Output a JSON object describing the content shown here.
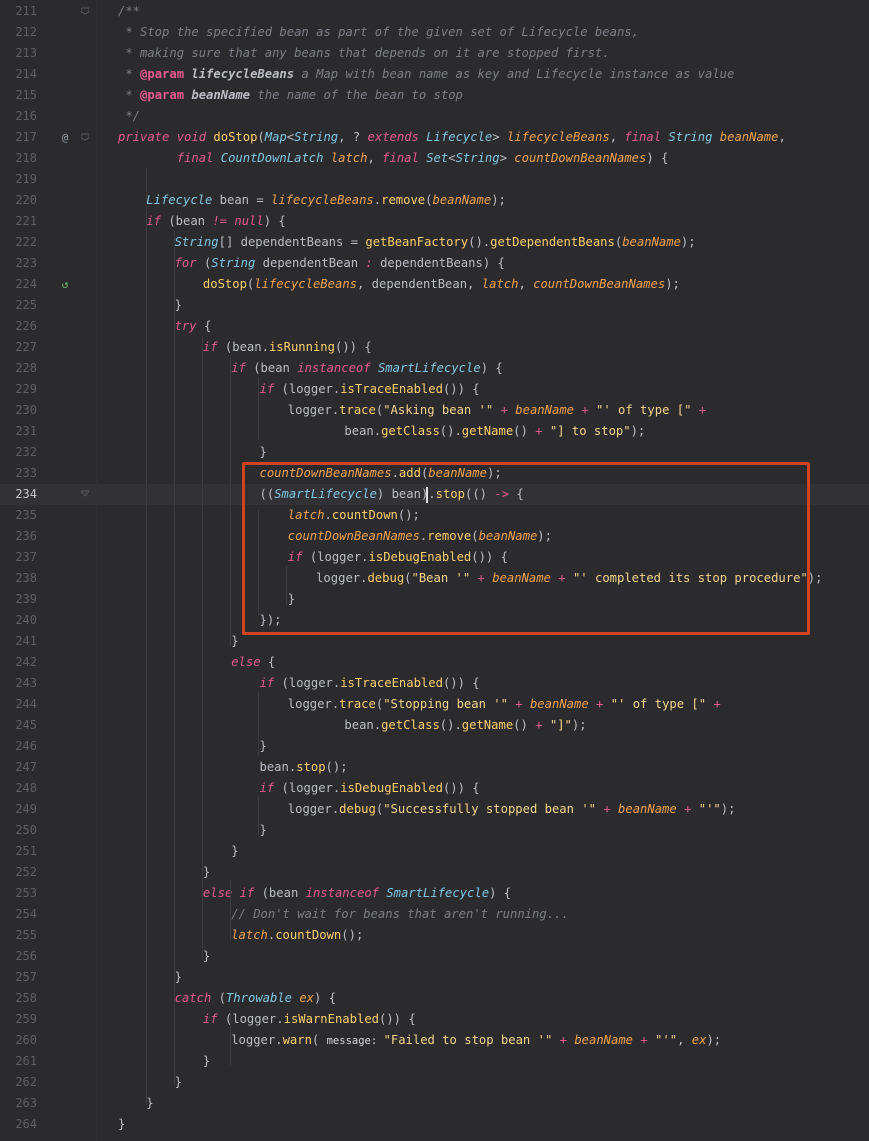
{
  "colors": {
    "background": "#2b2b2e",
    "keyword": "#ea5a8a",
    "type": "#7ec7e4",
    "method": "#ffcf6b",
    "field": "#f2a24d",
    "string": "#f5d68a",
    "comment": "#7d7f85",
    "plain": "#bcbec4",
    "highlight_box": "#d2431d"
  },
  "editor": {
    "first_line": 211,
    "current_line": 234,
    "lines": [
      {
        "n": 211,
        "indent": 0,
        "t": [
          [
            "/**",
            "c"
          ]
        ]
      },
      {
        "n": 212,
        "indent": 0,
        "t": [
          [
            " * Stop the specified bean as part of the given set of Lifecycle beans,",
            "c"
          ]
        ]
      },
      {
        "n": 213,
        "indent": 0,
        "t": [
          [
            " * making sure that any beans that depends on it are stopped first.",
            "c"
          ]
        ]
      },
      {
        "n": 214,
        "indent": 0,
        "t": [
          [
            " * ",
            "c"
          ],
          [
            "@param",
            "cb"
          ],
          [
            " lifecycleBeans",
            "cb2"
          ],
          [
            " a Map with bean name as key and Lifecycle instance as value",
            "c"
          ]
        ]
      },
      {
        "n": 215,
        "indent": 0,
        "t": [
          [
            " * ",
            "c"
          ],
          [
            "@param",
            "cb"
          ],
          [
            " beanName",
            "cb2"
          ],
          [
            " the name of the bean to stop",
            "c"
          ]
        ]
      },
      {
        "n": 216,
        "indent": 0,
        "t": [
          [
            " */",
            "c"
          ]
        ]
      },
      {
        "n": 217,
        "indent": 0,
        "t": [
          [
            "private void ",
            "k"
          ],
          [
            "doStop",
            "m"
          ],
          [
            "(",
            "p"
          ],
          [
            "Map",
            "t"
          ],
          [
            "<",
            "p"
          ],
          [
            "String",
            "t"
          ],
          [
            ", ? ",
            "p"
          ],
          [
            "extends ",
            "k"
          ],
          [
            "Lifecycle",
            "t"
          ],
          [
            "> ",
            "p"
          ],
          [
            "lifecycleBeans",
            "f"
          ],
          [
            ", ",
            "p"
          ],
          [
            "final ",
            "k"
          ],
          [
            "String ",
            "t"
          ],
          [
            "beanName",
            "f"
          ],
          [
            ",",
            "p"
          ]
        ]
      },
      {
        "n": 218,
        "indent": 0,
        "t": [
          [
            "        final ",
            "k"
          ],
          [
            "CountDownLatch ",
            "t"
          ],
          [
            "latch",
            "f"
          ],
          [
            ", ",
            "p"
          ],
          [
            "final ",
            "k"
          ],
          [
            "Set",
            "t"
          ],
          [
            "<",
            "p"
          ],
          [
            "String",
            "t"
          ],
          [
            "> ",
            "p"
          ],
          [
            "countDownBeanNames",
            "f"
          ],
          [
            ") {",
            "p"
          ]
        ]
      },
      {
        "n": 219,
        "indent": 0,
        "t": []
      },
      {
        "n": 220,
        "indent": 1,
        "t": [
          [
            "Lifecycle ",
            "t"
          ],
          [
            "bean = ",
            "p"
          ],
          [
            "lifecycleBeans",
            "f"
          ],
          [
            ".",
            "p"
          ],
          [
            "remove",
            "m"
          ],
          [
            "(",
            "p"
          ],
          [
            "beanName",
            "f"
          ],
          [
            ");",
            "p"
          ]
        ]
      },
      {
        "n": 221,
        "indent": 1,
        "t": [
          [
            "if ",
            "k"
          ],
          [
            "(bean ",
            "p"
          ],
          [
            "!= ",
            "k"
          ],
          [
            "null",
            "k"
          ],
          [
            ") {",
            "p"
          ]
        ]
      },
      {
        "n": 222,
        "indent": 2,
        "t": [
          [
            "String",
            "t"
          ],
          [
            "[] dependentBeans = ",
            "p"
          ],
          [
            "getBeanFactory",
            "m"
          ],
          [
            "().",
            "p"
          ],
          [
            "getDependentBeans",
            "m"
          ],
          [
            "(",
            "p"
          ],
          [
            "beanName",
            "f"
          ],
          [
            ");",
            "p"
          ]
        ]
      },
      {
        "n": 223,
        "indent": 2,
        "t": [
          [
            "for ",
            "k"
          ],
          [
            "(",
            "p"
          ],
          [
            "String ",
            "t"
          ],
          [
            "dependentBean ",
            "p"
          ],
          [
            ": ",
            "k"
          ],
          [
            "dependentBeans) {",
            "p"
          ]
        ]
      },
      {
        "n": 224,
        "indent": 3,
        "t": [
          [
            "doStop",
            "m"
          ],
          [
            "(",
            "p"
          ],
          [
            "lifecycleBeans",
            "f"
          ],
          [
            ", dependentBean, ",
            "p"
          ],
          [
            "latch",
            "f"
          ],
          [
            ", ",
            "p"
          ],
          [
            "countDownBeanNames",
            "f"
          ],
          [
            ");",
            "p"
          ]
        ]
      },
      {
        "n": 225,
        "indent": 2,
        "t": [
          [
            "}",
            "p"
          ]
        ]
      },
      {
        "n": 226,
        "indent": 2,
        "t": [
          [
            "try ",
            "k"
          ],
          [
            "{",
            "p"
          ]
        ]
      },
      {
        "n": 227,
        "indent": 3,
        "t": [
          [
            "if ",
            "k"
          ],
          [
            "(bean.",
            "p"
          ],
          [
            "isRunning",
            "m"
          ],
          [
            "()) {",
            "p"
          ]
        ]
      },
      {
        "n": 228,
        "indent": 4,
        "t": [
          [
            "if ",
            "k"
          ],
          [
            "(bean ",
            "p"
          ],
          [
            "instanceof ",
            "k"
          ],
          [
            "SmartLifecycle",
            "t"
          ],
          [
            ") {",
            "p"
          ]
        ]
      },
      {
        "n": 229,
        "indent": 5,
        "t": [
          [
            "if ",
            "k"
          ],
          [
            "(logger.",
            "p"
          ],
          [
            "isTraceEnabled",
            "m"
          ],
          [
            "()) {",
            "p"
          ]
        ]
      },
      {
        "n": 230,
        "indent": 6,
        "t": [
          [
            "logger.",
            "p"
          ],
          [
            "trace",
            "m"
          ],
          [
            "(",
            "p"
          ],
          [
            "\"Asking bean '\" ",
            "s"
          ],
          [
            "+ ",
            "k"
          ],
          [
            "beanName ",
            "f"
          ],
          [
            "+ ",
            "k"
          ],
          [
            "\"' of type [\" ",
            "s"
          ],
          [
            "+",
            "k"
          ]
        ]
      },
      {
        "n": 231,
        "indent": 8,
        "t": [
          [
            "bean.",
            "p"
          ],
          [
            "getClass",
            "m"
          ],
          [
            "().",
            "p"
          ],
          [
            "getName",
            "m"
          ],
          [
            "() ",
            "p"
          ],
          [
            "+ ",
            "k"
          ],
          [
            "\"] to stop\"",
            "s"
          ],
          [
            ");",
            "p"
          ]
        ]
      },
      {
        "n": 232,
        "indent": 5,
        "t": [
          [
            "}",
            "p"
          ]
        ]
      },
      {
        "n": 233,
        "indent": 5,
        "t": [
          [
            "countDownBeanNames",
            "f"
          ],
          [
            ".",
            "p"
          ],
          [
            "add",
            "m"
          ],
          [
            "(",
            "p"
          ],
          [
            "beanName",
            "f"
          ],
          [
            ");",
            "p"
          ]
        ]
      },
      {
        "n": 234,
        "indent": 5,
        "t": [
          [
            "((",
            "p"
          ],
          [
            "SmartLifecycle",
            "t"
          ],
          [
            ") bean).",
            "p"
          ],
          [
            "stop",
            "m"
          ],
          [
            "(() ",
            "p"
          ],
          [
            "-> ",
            "k"
          ],
          [
            "{",
            "p"
          ]
        ]
      },
      {
        "n": 235,
        "indent": 6,
        "t": [
          [
            "latch",
            "f"
          ],
          [
            ".",
            "p"
          ],
          [
            "countDown",
            "m"
          ],
          [
            "();",
            "p"
          ]
        ]
      },
      {
        "n": 236,
        "indent": 6,
        "t": [
          [
            "countDownBeanNames",
            "f"
          ],
          [
            ".",
            "p"
          ],
          [
            "remove",
            "m"
          ],
          [
            "(",
            "p"
          ],
          [
            "beanName",
            "f"
          ],
          [
            ");",
            "p"
          ]
        ]
      },
      {
        "n": 237,
        "indent": 6,
        "t": [
          [
            "if ",
            "k"
          ],
          [
            "(logger.",
            "p"
          ],
          [
            "isDebugEnabled",
            "m"
          ],
          [
            "()) {",
            "p"
          ]
        ]
      },
      {
        "n": 238,
        "indent": 7,
        "t": [
          [
            "logger.",
            "p"
          ],
          [
            "debug",
            "m"
          ],
          [
            "(",
            "p"
          ],
          [
            "\"Bean '\" ",
            "s"
          ],
          [
            "+ ",
            "k"
          ],
          [
            "beanName ",
            "f"
          ],
          [
            "+ ",
            "k"
          ],
          [
            "\"' completed its stop procedure\"",
            "s"
          ],
          [
            ");",
            "p"
          ]
        ]
      },
      {
        "n": 239,
        "indent": 6,
        "t": [
          [
            "}",
            "p"
          ]
        ]
      },
      {
        "n": 240,
        "indent": 5,
        "t": [
          [
            "});",
            "p"
          ]
        ]
      },
      {
        "n": 241,
        "indent": 4,
        "t": [
          [
            "}",
            "p"
          ]
        ]
      },
      {
        "n": 242,
        "indent": 4,
        "t": [
          [
            "else ",
            "k"
          ],
          [
            "{",
            "p"
          ]
        ]
      },
      {
        "n": 243,
        "indent": 5,
        "t": [
          [
            "if ",
            "k"
          ],
          [
            "(logger.",
            "p"
          ],
          [
            "isTraceEnabled",
            "m"
          ],
          [
            "()) {",
            "p"
          ]
        ]
      },
      {
        "n": 244,
        "indent": 6,
        "t": [
          [
            "logger.",
            "p"
          ],
          [
            "trace",
            "m"
          ],
          [
            "(",
            "p"
          ],
          [
            "\"Stopping bean '\" ",
            "s"
          ],
          [
            "+ ",
            "k"
          ],
          [
            "beanName ",
            "f"
          ],
          [
            "+ ",
            "k"
          ],
          [
            "\"' of type [\" ",
            "s"
          ],
          [
            "+",
            "k"
          ]
        ]
      },
      {
        "n": 245,
        "indent": 8,
        "t": [
          [
            "bean.",
            "p"
          ],
          [
            "getClass",
            "m"
          ],
          [
            "().",
            "p"
          ],
          [
            "getName",
            "m"
          ],
          [
            "() ",
            "p"
          ],
          [
            "+ ",
            "k"
          ],
          [
            "\"]\"",
            "s"
          ],
          [
            ");",
            "p"
          ]
        ]
      },
      {
        "n": 246,
        "indent": 5,
        "t": [
          [
            "}",
            "p"
          ]
        ]
      },
      {
        "n": 247,
        "indent": 5,
        "t": [
          [
            "bean.",
            "p"
          ],
          [
            "stop",
            "m"
          ],
          [
            "();",
            "p"
          ]
        ]
      },
      {
        "n": 248,
        "indent": 5,
        "t": [
          [
            "if ",
            "k"
          ],
          [
            "(logger.",
            "p"
          ],
          [
            "isDebugEnabled",
            "m"
          ],
          [
            "()) {",
            "p"
          ]
        ]
      },
      {
        "n": 249,
        "indent": 6,
        "t": [
          [
            "logger.",
            "p"
          ],
          [
            "debug",
            "m"
          ],
          [
            "(",
            "p"
          ],
          [
            "\"Successfully stopped bean '\" ",
            "s"
          ],
          [
            "+ ",
            "k"
          ],
          [
            "beanName ",
            "f"
          ],
          [
            "+ ",
            "k"
          ],
          [
            "\"'\"",
            "s"
          ],
          [
            ");",
            "p"
          ]
        ]
      },
      {
        "n": 250,
        "indent": 5,
        "t": [
          [
            "}",
            "p"
          ]
        ]
      },
      {
        "n": 251,
        "indent": 4,
        "t": [
          [
            "}",
            "p"
          ]
        ]
      },
      {
        "n": 252,
        "indent": 3,
        "t": [
          [
            "}",
            "p"
          ]
        ]
      },
      {
        "n": 253,
        "indent": 3,
        "t": [
          [
            "else if ",
            "k"
          ],
          [
            "(bean ",
            "p"
          ],
          [
            "instanceof ",
            "k"
          ],
          [
            "SmartLifecycle",
            "t"
          ],
          [
            ") {",
            "p"
          ]
        ]
      },
      {
        "n": 254,
        "indent": 4,
        "t": [
          [
            "// Don't wait for beans that aren't running...",
            "c"
          ]
        ]
      },
      {
        "n": 255,
        "indent": 4,
        "t": [
          [
            "latch",
            "f"
          ],
          [
            ".",
            "p"
          ],
          [
            "countDown",
            "m"
          ],
          [
            "();",
            "p"
          ]
        ]
      },
      {
        "n": 256,
        "indent": 3,
        "t": [
          [
            "}",
            "p"
          ]
        ]
      },
      {
        "n": 257,
        "indent": 2,
        "t": [
          [
            "}",
            "p"
          ]
        ]
      },
      {
        "n": 258,
        "indent": 2,
        "t": [
          [
            "catch ",
            "k"
          ],
          [
            "(",
            "p"
          ],
          [
            "Throwable ",
            "t"
          ],
          [
            "ex",
            "f"
          ],
          [
            ") {",
            "p"
          ]
        ]
      },
      {
        "n": 259,
        "indent": 3,
        "t": [
          [
            "if ",
            "k"
          ],
          [
            "(logger.",
            "p"
          ],
          [
            "isWarnEnabled",
            "m"
          ],
          [
            "()) {",
            "p"
          ]
        ]
      },
      {
        "n": 260,
        "indent": 4,
        "t": [
          [
            "logger.",
            "p"
          ],
          [
            "warn",
            "m"
          ],
          [
            "( ",
            "p"
          ],
          [
            "message: ",
            "h"
          ],
          [
            "\"Failed to stop bean '\" ",
            "s"
          ],
          [
            "+ ",
            "k"
          ],
          [
            "beanName ",
            "f"
          ],
          [
            "+ ",
            "k"
          ],
          [
            "\"'\"",
            "s"
          ],
          [
            ", ",
            "p"
          ],
          [
            "ex",
            "f"
          ],
          [
            ");",
            "p"
          ]
        ]
      },
      {
        "n": 261,
        "indent": 3,
        "t": [
          [
            "}",
            "p"
          ]
        ]
      },
      {
        "n": 262,
        "indent": 2,
        "t": [
          [
            "}",
            "p"
          ]
        ]
      },
      {
        "n": 263,
        "indent": 1,
        "t": [
          [
            "}",
            "p"
          ]
        ]
      },
      {
        "n": 264,
        "indent": 0,
        "t": [
          [
            "}",
            "p"
          ]
        ]
      }
    ],
    "gutter_icons": {
      "217": "at-icon",
      "224": "recursion-icon"
    }
  }
}
